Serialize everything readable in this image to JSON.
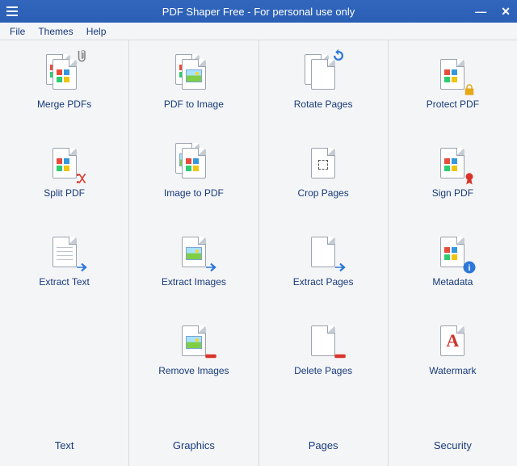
{
  "titlebar": {
    "title": "PDF Shaper Free - For personal use only"
  },
  "menu": {
    "file": "File",
    "themes": "Themes",
    "help": "Help"
  },
  "columns": [
    {
      "header": "Text",
      "items": [
        {
          "label": "Merge PDFs",
          "name": "merge-pdfs-button"
        },
        {
          "label": "Split PDF",
          "name": "split-pdf-button"
        },
        {
          "label": "Extract Text",
          "name": "extract-text-button"
        },
        {
          "label": "",
          "name": ""
        }
      ]
    },
    {
      "header": "Graphics",
      "items": [
        {
          "label": "PDF to Image",
          "name": "pdf-to-image-button"
        },
        {
          "label": "Image to PDF",
          "name": "image-to-pdf-button"
        },
        {
          "label": "Extract Images",
          "name": "extract-images-button"
        },
        {
          "label": "Remove Images",
          "name": "remove-images-button"
        }
      ]
    },
    {
      "header": "Pages",
      "items": [
        {
          "label": "Rotate Pages",
          "name": "rotate-pages-button"
        },
        {
          "label": "Crop Pages",
          "name": "crop-pages-button"
        },
        {
          "label": "Extract Pages",
          "name": "extract-pages-button"
        },
        {
          "label": "Delete Pages",
          "name": "delete-pages-button"
        }
      ]
    },
    {
      "header": "Security",
      "items": [
        {
          "label": "Protect PDF",
          "name": "protect-pdf-button"
        },
        {
          "label": "Sign PDF",
          "name": "sign-pdf-button"
        },
        {
          "label": "Metadata",
          "name": "metadata-button"
        },
        {
          "label": "Watermark",
          "name": "watermark-button"
        }
      ]
    }
  ]
}
